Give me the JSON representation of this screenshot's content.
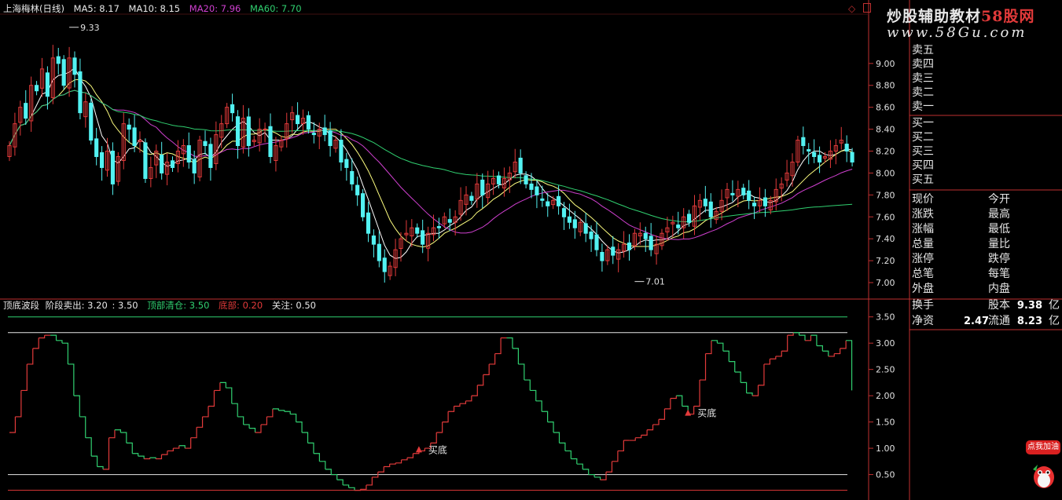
{
  "window": {
    "title": "上海梅林(日线)"
  },
  "ma_header": [
    {
      "label": "MA5: 8.17",
      "color": "#e8e8e8"
    },
    {
      "label": "MA10: 8.15",
      "color": "#e8e8e8"
    },
    {
      "label": "MA20: 7.96",
      "color": "#d040d0"
    },
    {
      "label": "MA60: 7.70",
      "color": "#30d070"
    }
  ],
  "indicator_header": [
    {
      "label": "顶底波段",
      "color": "#e8e8e8"
    },
    {
      "label": "阶段卖出: 3.20",
      "color": "#e8e8e8"
    },
    {
      "label": ": 3.50",
      "color": "#e8e8e8"
    },
    {
      "label": "顶部清仓: 3.50",
      "color": "#30d070"
    },
    {
      "label": "底部: 0.20",
      "color": "#e23a3a"
    },
    {
      "label": "关注: 0.50",
      "color": "#e8e8e8"
    }
  ],
  "watermark": {
    "line1": "炒股辅助教材",
    "line1_red": "58股网",
    "line2": "www.58Gu.com"
  },
  "order_book": {
    "sell": [
      "卖五",
      "卖四",
      "卖三",
      "卖二",
      "卖一"
    ],
    "buy": [
      "买一",
      "买二",
      "买三",
      "买四",
      "买五"
    ]
  },
  "quote_fields": [
    [
      "现价",
      "今开"
    ],
    [
      "涨跌",
      "最高"
    ],
    [
      "涨幅",
      "最低"
    ],
    [
      "总量",
      "量比"
    ],
    [
      "涨停",
      "跌停"
    ],
    [
      "总笔",
      "每笔"
    ],
    [
      "外盘",
      "内盘"
    ]
  ],
  "finance_fields": [
    {
      "label1": "换手",
      "value1": "",
      "label2": "股本",
      "value2": "9.38",
      "unit2": "亿"
    },
    {
      "label1": "净资",
      "value1": "2.47",
      "label2": "流通",
      "value2": "8.23",
      "unit2": "亿"
    }
  ],
  "badge": {
    "label": "点我加油"
  },
  "colors": {
    "up": "#e23a3a",
    "down": "#53f2f2",
    "ma5": "#ffffff",
    "ma10": "#ffff80",
    "ma20": "#d040d0",
    "ma60": "#30d070",
    "border": "#c03030",
    "indicator_up": "#e23a3a",
    "indicator_down": "#30d070"
  },
  "chart_data": [
    {
      "type": "candlestick",
      "title": "上海梅林(日线)",
      "ylim": [
        6.9,
        9.45
      ],
      "y_ticks": [
        "9.00",
        "8.80",
        "8.60",
        "8.40",
        "8.20",
        "8.00",
        "7.80",
        "7.60",
        "7.40",
        "7.20",
        "7.00"
      ],
      "annotations": [
        {
          "text": "9.33",
          "x_index": 11,
          "y": 9.33
        },
        {
          "text": "7.01",
          "x_index": 115,
          "y": 7.01
        }
      ],
      "close_series": [
        8.25,
        8.45,
        8.6,
        8.5,
        8.8,
        8.75,
        8.95,
        8.7,
        9.05,
        9.0,
        8.8,
        9.05,
        8.9,
        8.55,
        8.65,
        8.3,
        8.15,
        8.05,
        8.2,
        7.9,
        8.15,
        8.45,
        8.4,
        8.25,
        8.3,
        7.95,
        8.05,
        8.2,
        8.0,
        8.1,
        8.05,
        8.2,
        8.25,
        8.1,
        8.0,
        8.3,
        8.25,
        8.05,
        8.35,
        8.45,
        8.6,
        8.55,
        8.25,
        8.5,
        8.25,
        8.3,
        8.4,
        8.4,
        8.15,
        8.25,
        8.3,
        8.45,
        8.55,
        8.45,
        8.5,
        8.4,
        8.35,
        8.4,
        8.35,
        8.25,
        8.3,
        8.1,
        8.05,
        7.9,
        7.8,
        7.6,
        7.45,
        7.35,
        7.2,
        7.1,
        7.15,
        7.3,
        7.4,
        7.45,
        7.5,
        7.45,
        7.35,
        7.45,
        7.5,
        7.5,
        7.6,
        7.55,
        7.6,
        7.75,
        7.8,
        7.75,
        7.9,
        7.8,
        7.9,
        7.95,
        7.9,
        7.95,
        8.0,
        8.1,
        8.0,
        7.9,
        7.85,
        7.8,
        7.75,
        7.7,
        7.75,
        7.7,
        7.6,
        7.55,
        7.5,
        7.55,
        7.45,
        7.4,
        7.3,
        7.2,
        7.3,
        7.25,
        7.3,
        7.35,
        7.3,
        7.45,
        7.45,
        7.4,
        7.3,
        7.35,
        7.45,
        7.5,
        7.55,
        7.5,
        7.6,
        7.55,
        7.7,
        7.75,
        7.7,
        7.6,
        7.65,
        7.75,
        7.85,
        7.8,
        7.85,
        7.8,
        7.75,
        7.7,
        7.75,
        7.7,
        7.75,
        7.85,
        7.9,
        8.0,
        8.1,
        8.3,
        8.25,
        8.2,
        8.15,
        8.1,
        8.15,
        8.2,
        8.25,
        8.3,
        8.2,
        8.1
      ],
      "ma5_end": 8.17,
      "ma10_end": 8.15,
      "ma20_end": 7.96,
      "ma60_end": 7.7
    },
    {
      "type": "line",
      "title": "顶底波段",
      "ylim": [
        0.15,
        3.6
      ],
      "y_ticks": [
        "3.50",
        "3.00",
        "2.50",
        "2.00",
        "1.50",
        "1.00",
        "0.50"
      ],
      "reference_lines": [
        3.5,
        3.2,
        0.5,
        0.2
      ],
      "markers": [
        {
          "text": "买底",
          "x_index": 70
        },
        {
          "text": "买底",
          "x_index": 116
        }
      ],
      "values": [
        1.3,
        1.6,
        2.1,
        2.6,
        2.9,
        3.1,
        3.15,
        3.15,
        3.05,
        3.0,
        2.6,
        2.0,
        1.6,
        1.2,
        0.85,
        0.65,
        0.6,
        1.2,
        1.35,
        1.3,
        1.1,
        0.9,
        0.85,
        0.8,
        0.82,
        0.8,
        0.88,
        0.95,
        1.0,
        1.05,
        1.0,
        1.2,
        1.4,
        1.6,
        1.8,
        2.1,
        2.25,
        2.15,
        1.85,
        1.6,
        1.45,
        1.38,
        1.3,
        1.45,
        1.6,
        1.75,
        1.72,
        1.7,
        1.65,
        1.5,
        1.3,
        1.1,
        0.9,
        0.75,
        0.6,
        0.5,
        0.4,
        0.3,
        0.25,
        0.2,
        0.22,
        0.3,
        0.45,
        0.55,
        0.65,
        0.7,
        0.72,
        0.78,
        0.82,
        0.9,
        0.95,
        1.0,
        1.1,
        1.3,
        1.5,
        1.7,
        1.8,
        1.85,
        1.9,
        2.0,
        2.2,
        2.4,
        2.6,
        2.8,
        3.1,
        3.1,
        2.9,
        2.6,
        2.3,
        2.1,
        1.9,
        1.7,
        1.5,
        1.3,
        1.1,
        0.95,
        0.8,
        0.7,
        0.6,
        0.5,
        0.45,
        0.4,
        0.55,
        0.75,
        0.95,
        1.15,
        1.15,
        1.2,
        1.25,
        1.35,
        1.45,
        1.55,
        1.75,
        1.95,
        2.0,
        1.8,
        1.65,
        1.8,
        2.3,
        2.8,
        3.05,
        3.0,
        2.85,
        2.65,
        2.45,
        2.25,
        2.05,
        2.0,
        2.2,
        2.6,
        2.7,
        2.75,
        2.85,
        3.15,
        3.2,
        3.15,
        3.05,
        3.15,
        2.95,
        2.85,
        2.75,
        2.8,
        2.9,
        3.05,
        2.1
      ]
    }
  ]
}
